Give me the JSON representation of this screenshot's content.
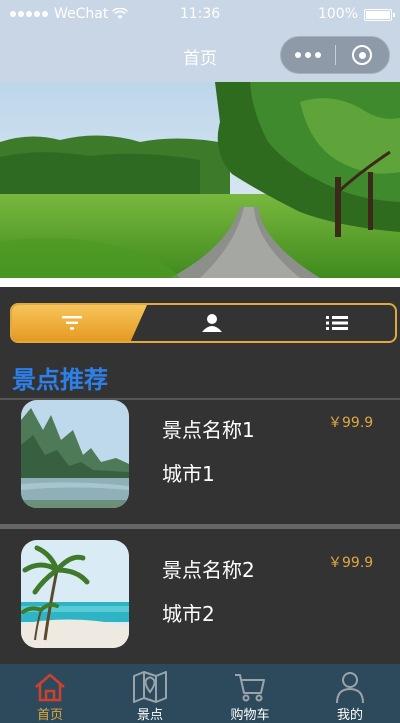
{
  "status_bar": {
    "carrier": "WeChat",
    "time": "11:36",
    "battery": "100%"
  },
  "nav": {
    "title": "首页"
  },
  "banner": {
    "icon": "landscape-photo"
  },
  "filter_bar": {
    "active_index": 0,
    "icons": [
      "filter-icon",
      "user-icon",
      "list-icon"
    ]
  },
  "section": {
    "title": "景点推荐"
  },
  "items": [
    {
      "name": "景点名称1",
      "city": "城市1",
      "price": "￥99.9",
      "image": "karst-river-photo"
    },
    {
      "name": "景点名称2",
      "city": "城市2",
      "price": "￥99.9",
      "image": "palm-beach-photo"
    }
  ],
  "tabbar": {
    "tabs": [
      {
        "label": "首页",
        "icon": "home-icon",
        "active": true
      },
      {
        "label": "景点",
        "icon": "map-icon",
        "active": false
      },
      {
        "label": "购物车",
        "icon": "cart-icon",
        "active": false
      },
      {
        "label": "我的",
        "icon": "person-icon",
        "active": false
      }
    ]
  },
  "colors": {
    "accent": "#e0a83e",
    "section_title": "#2f7fe8",
    "background": "#333333",
    "tabbar": "#2d4a5c",
    "active_tab_icon": "#d0402a"
  }
}
